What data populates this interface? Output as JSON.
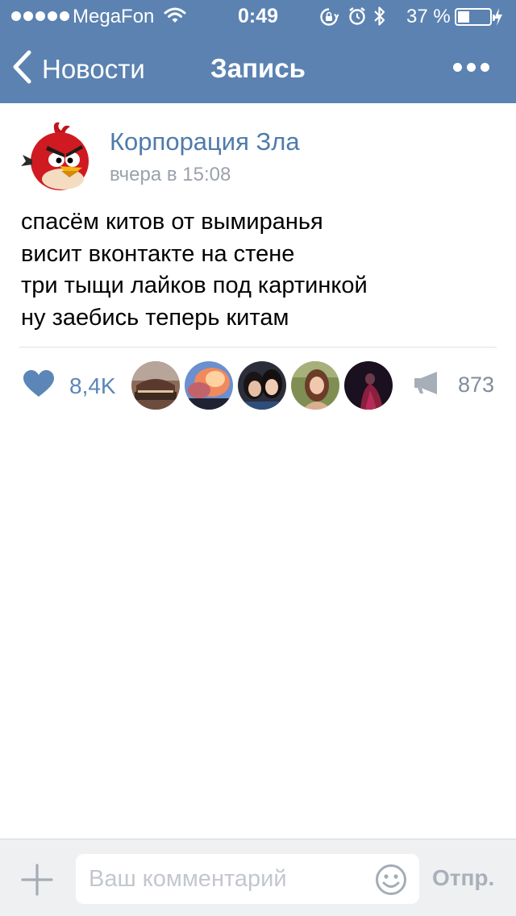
{
  "status_bar": {
    "carrier": "MegaFon",
    "time": "0:49",
    "battery_percent": "37 %",
    "battery_level": 0.37,
    "icons": [
      "signal-dots-icon",
      "wifi-icon",
      "rotation-lock-icon",
      "alarm-icon",
      "bluetooth-icon",
      "battery-icon",
      "charging-icon"
    ]
  },
  "nav": {
    "back_label": "Новости",
    "title": "Запись",
    "more_icon": "more-dots-icon"
  },
  "post": {
    "author": "Корпорация Зла",
    "date": "вчера в 15:08",
    "avatar_icon": "angry-bird-avatar",
    "lines": [
      "спасём китов от вымиранья",
      "висит вконтакте на стене",
      "три тыщи лайков под картинкой",
      "ну заебись теперь китам"
    ]
  },
  "actions": {
    "likes": "8,4K",
    "shares": "873",
    "like_icon": "heart-icon",
    "share_icon": "megaphone-icon"
  },
  "comment_bar": {
    "placeholder": "Ваш комментарий",
    "send_label": "Отпр.",
    "attach_icon": "plus-icon",
    "emoji_icon": "smiley-icon"
  },
  "colors": {
    "header": "#5b82b1",
    "link": "#4f7bab",
    "like": "#5b86b7"
  }
}
